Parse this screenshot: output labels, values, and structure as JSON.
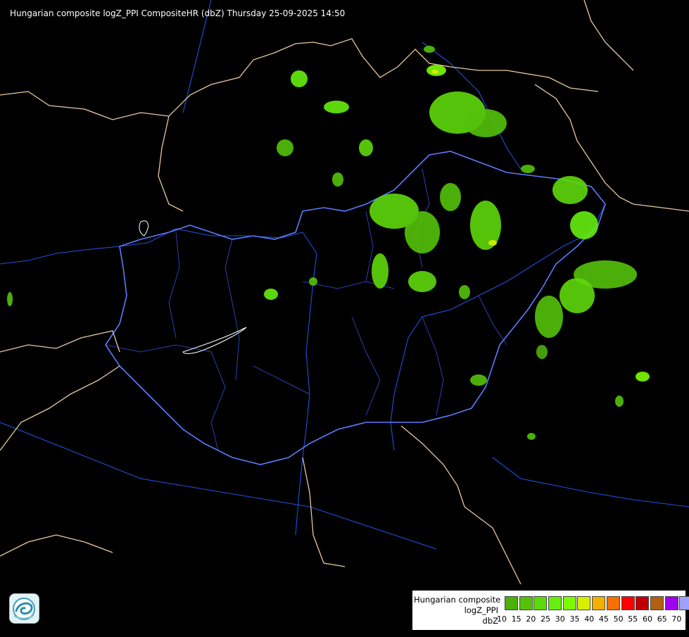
{
  "title": "Hungarian composite logZ_PPI CompositeHR (dbZ) Thursday 25-09-2025 14:50",
  "legend": {
    "lines": [
      "Hungarian composite",
      "logZ_PPI",
      "dbZ"
    ],
    "scale": [
      {
        "label": "10",
        "color": "#4caf0a"
      },
      {
        "label": "15",
        "color": "#54c20a"
      },
      {
        "label": "20",
        "color": "#5fd80c"
      },
      {
        "label": "25",
        "color": "#66ee10"
      },
      {
        "label": "30",
        "color": "#7cfc00"
      },
      {
        "label": "35",
        "color": "#d8f000"
      },
      {
        "label": "40",
        "color": "#f4b000"
      },
      {
        "label": "45",
        "color": "#f47000"
      },
      {
        "label": "50",
        "color": "#ff0000"
      },
      {
        "label": "55",
        "color": "#c00000"
      },
      {
        "label": "60",
        "color": "#b06010"
      },
      {
        "label": "65",
        "color": "#a000f0"
      },
      {
        "label": "70",
        "color": "#a0a0ff"
      }
    ]
  },
  "colors": {
    "background": "#000000",
    "country_border": "#e8c8a0",
    "river": "#2050e0",
    "county_border": "#2a40b0",
    "lakes": "#ffffff"
  },
  "logo": "omsz-logo-icon"
}
